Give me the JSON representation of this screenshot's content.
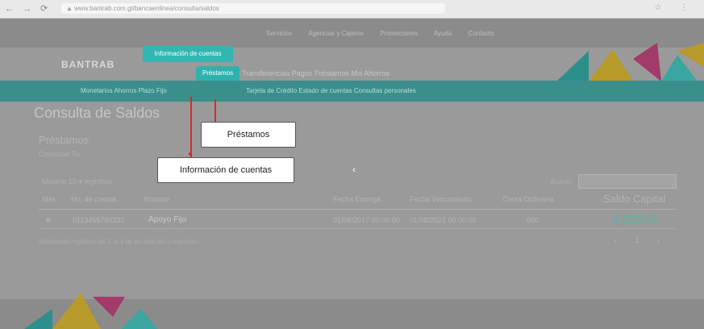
{
  "browser": {
    "nav_buttons": "← → ⟳",
    "address": "▲ www.bantrab.com.gt/bancaenlinea/consulta/saldos",
    "right_icons": "☆ ⋮"
  },
  "site": {
    "logo_text": "BANTRAB",
    "top_menu": [
      "Servicios",
      "Agencias y Cajeros",
      "Promociones",
      "Ayuda",
      "Contacto"
    ],
    "main_menu_rest": "Transferencias  Pagos  Préstamos  Mis Ahorros",
    "active_tab": "Información de cuentas",
    "submenu_left": "Monetarios  Ahorros  Plazo Fijo",
    "active_subtab": "Préstamos",
    "submenu_right": "Tarjeta de Crédito  Estado de cuentas  Consultas personales"
  },
  "content": {
    "page_title": "Consulta de Saldos",
    "section_title": "Préstamos",
    "section_subtitle": "Consultar Tu",
    "show_entries": "Mostrar  10 ▾  registros",
    "search_label": "Buscar:",
    "table": {
      "headers": [
        "Más",
        "No. de cuenta",
        "Nombre",
        "Fecha Entrega",
        "Fecha Vencimiento",
        "Cuota Ordinaria",
        "Saldo Capital"
      ],
      "rows": [
        {
          "more": "⊕",
          "account": "0113456789332",
          "name": "Apoyo Fijo",
          "delivery": "01/08/2017 00:00:00",
          "due": "01/08/2021 00:00:00",
          "quota": "000",
          "balance": "2,500.00"
        }
      ]
    },
    "footer_info": "Mostrando registros del 1 al 1 de un total de 1 registros",
    "pager": "‹ 1 ›"
  },
  "callouts": {
    "prestamos": "Préstamos",
    "cuentas": "Información de cuentas"
  },
  "colors": {
    "accent_teal": "#35b5b2",
    "annotation_red": "#d62b2b"
  }
}
